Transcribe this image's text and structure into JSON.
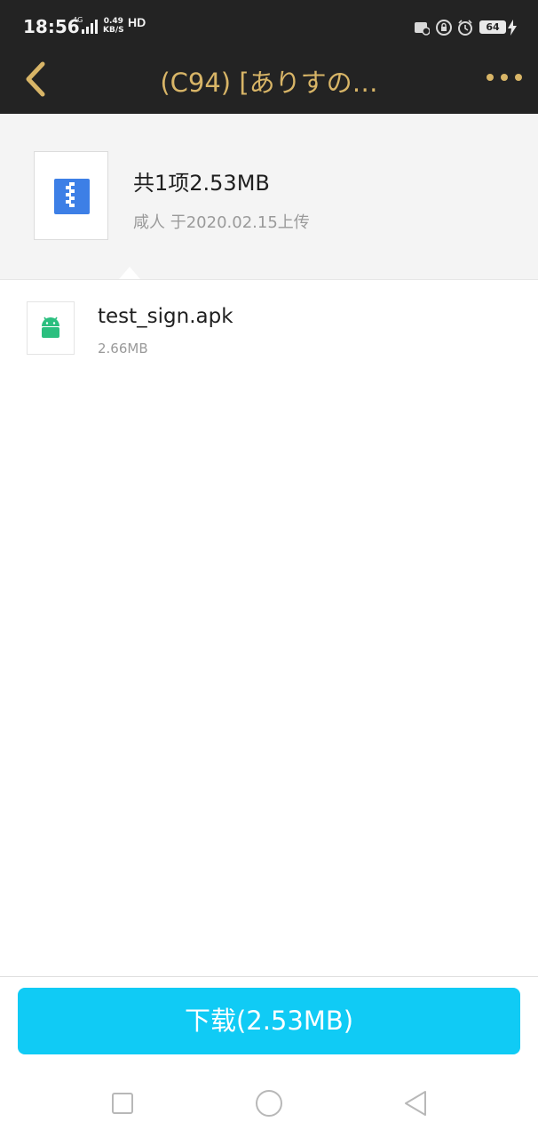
{
  "status_bar": {
    "time": "18:56",
    "network_type": "4G",
    "net_speed_value": "0.49",
    "net_speed_unit": "KB/S",
    "hd_label": "HD",
    "battery_level": "64",
    "icons": [
      "notification-icon",
      "vpn-lock-icon",
      "alarm-icon",
      "battery-icon",
      "charging-icon"
    ]
  },
  "title_bar": {
    "title": "(C94) [ありすの…",
    "back_icon": "chevron-left-icon",
    "more_icon": "more-dots-icon"
  },
  "summary": {
    "title": "共1项2.53MB",
    "subtitle": "咸人 于2020.02.15上传",
    "icon": "zip-file-icon"
  },
  "files": [
    {
      "name": "test_sign.apk",
      "size": "2.66MB",
      "icon": "android-icon"
    }
  ],
  "action": {
    "download_label": "下载(2.53MB)"
  },
  "nav_bar": {
    "icons": [
      "recent-apps-icon",
      "home-icon",
      "back-triangle-icon"
    ]
  },
  "colors": {
    "header_bg": "#232323",
    "title_gold": "#d8b567",
    "download_blue": "#10cbf5",
    "zip_blue": "#3d7fe6",
    "android_green": "#2bbf7f"
  }
}
